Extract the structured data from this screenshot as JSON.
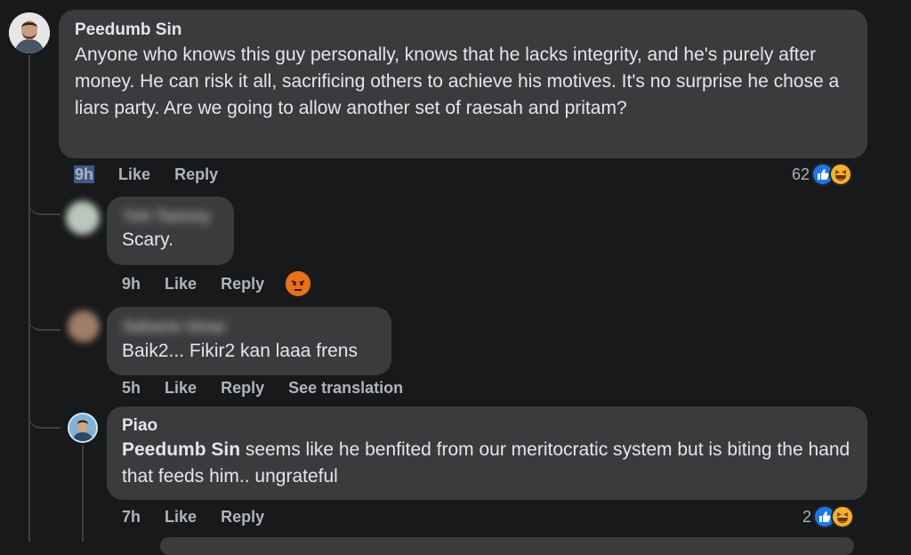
{
  "comments": [
    {
      "author": "Peedumb Sin",
      "text": "Anyone who knows this guy personally, knows that he lacks integrity, and he's purely after money. He can risk it all, sacrificing others to achieve his motives. It's no surprise he chose a liars party. Are we going to allow another set of raesah and pritam?",
      "time": "9h",
      "like_label": "Like",
      "reply_label": "Reply",
      "reaction_count": "62"
    },
    {
      "author": "Yeh Tammy",
      "text": "Scary.",
      "time": "9h",
      "like_label": "Like",
      "reply_label": "Reply"
    },
    {
      "author": "Saharie Umar",
      "text": "Baik2... Fikir2 kan laaa frens",
      "time": "5h",
      "like_label": "Like",
      "reply_label": "Reply",
      "translation_label": "See translation"
    },
    {
      "author": "Piao",
      "mention": "Peedumb Sin",
      "text": " seems like he benfited from our meritocratic system but is biting the hand that feeds him.. ungrateful",
      "time": "7h",
      "like_label": "Like",
      "reply_label": "Reply",
      "reaction_count": "2"
    }
  ],
  "icons": {
    "like": "like-icon",
    "haha": "haha-icon",
    "angry": "angry-icon"
  },
  "colors": {
    "background": "#18191a",
    "bubble": "#3a3b3c",
    "like_blue": "#1877f2",
    "haha_yellow": "#f7b125",
    "angry_orange": "#e9710f"
  }
}
